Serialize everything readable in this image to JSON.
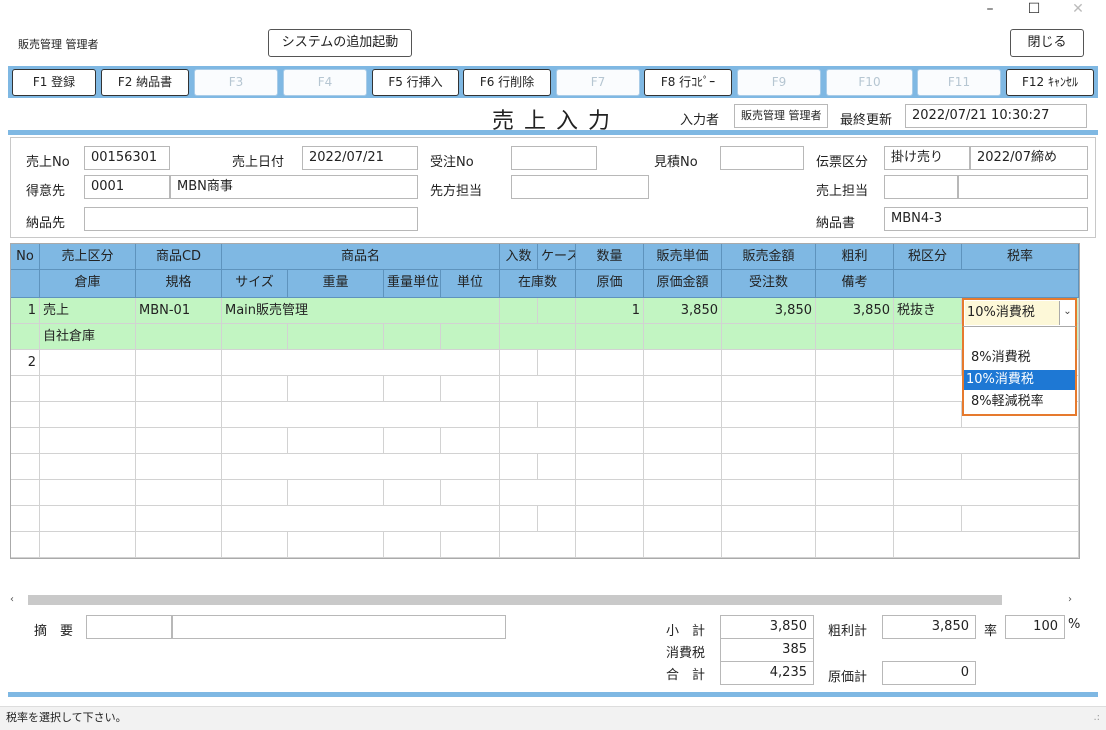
{
  "window": {
    "minimize_icon": "–",
    "maximize_icon": "☐",
    "close_icon": "✕"
  },
  "app_title": "販売管理 管理者",
  "buttons": {
    "add_system": "システムの追加起動",
    "close": "閉じる"
  },
  "fkeys": [
    "F1 登録",
    "F2 納品書",
    "F3",
    "F4",
    "F5 行挿入",
    "F6 行削除",
    "F7",
    "F8 行ｺﾋﾟｰ",
    "F9",
    "F10",
    "F11",
    "F12 ｷｬﾝｾﾙ"
  ],
  "screen_title": "売上入力",
  "meta": {
    "entered_by_label": "入力者",
    "entered_by": "販売管理 管理者",
    "updated_label": "最終更新",
    "updated": "2022/07/21 10:30:27"
  },
  "header": {
    "sale_no_label": "売上No",
    "sale_no": "00156301",
    "sale_date_label": "売上日付",
    "sale_date": "2022/07/21",
    "order_no_label": "受注No",
    "order_no": "",
    "quote_no_label": "見積No",
    "quote_no": "",
    "slip_type_label": "伝票区分",
    "slip_type": "掛け売り",
    "closing": "2022/07締め",
    "customer_label": "得意先",
    "customer_code": "0001",
    "customer_name": "MBN商事",
    "contact_label": "先方担当",
    "contact": "",
    "sales_rep_label": "売上担当",
    "sales_rep": "",
    "sales_rep2": "",
    "ship_to_label": "納品先",
    "ship_to": "",
    "delivery_note_label": "納品書",
    "delivery_note": "MBN4-3"
  },
  "grid": {
    "head1": [
      "No",
      "売上区分",
      "商品CD",
      "商品名",
      "入数",
      "ケース",
      "数量",
      "販売単価",
      "販売金額",
      "粗利",
      "税区分",
      "税率"
    ],
    "head2": [
      "倉庫",
      "規格",
      "サイズ",
      "重量",
      "重量単位",
      "単位",
      "在庫数",
      "原価",
      "原価金額",
      "受注数",
      "備考"
    ],
    "row1": {
      "no": "1",
      "type": "売上",
      "code": "MBN-01",
      "name": "Main販売管理",
      "qty": "1",
      "price": "3,850",
      "amount": "3,850",
      "profit": "3,850",
      "tax_type": "税抜き",
      "tax_rate": "10%消費税",
      "warehouse": "自社倉庫"
    },
    "row2": {
      "no": "2"
    }
  },
  "tax_dropdown": {
    "options": [
      "8%消費税",
      "10%消費税",
      "8%軽減税率"
    ],
    "selected": "10%消費税"
  },
  "summary": {
    "memo_label": "摘　要",
    "subtotal_label": "小　計",
    "subtotal": "3,850",
    "tax_label": "消費税",
    "tax": "385",
    "total_label": "合　計",
    "total": "4,235",
    "profit_total_label": "粗利計",
    "profit_total": "3,850",
    "rate_label": "率",
    "rate": "100",
    "rate_unit": "%",
    "cost_total_label": "原価計",
    "cost_total": "0"
  },
  "status_message": "税率を選択して下さい。"
}
